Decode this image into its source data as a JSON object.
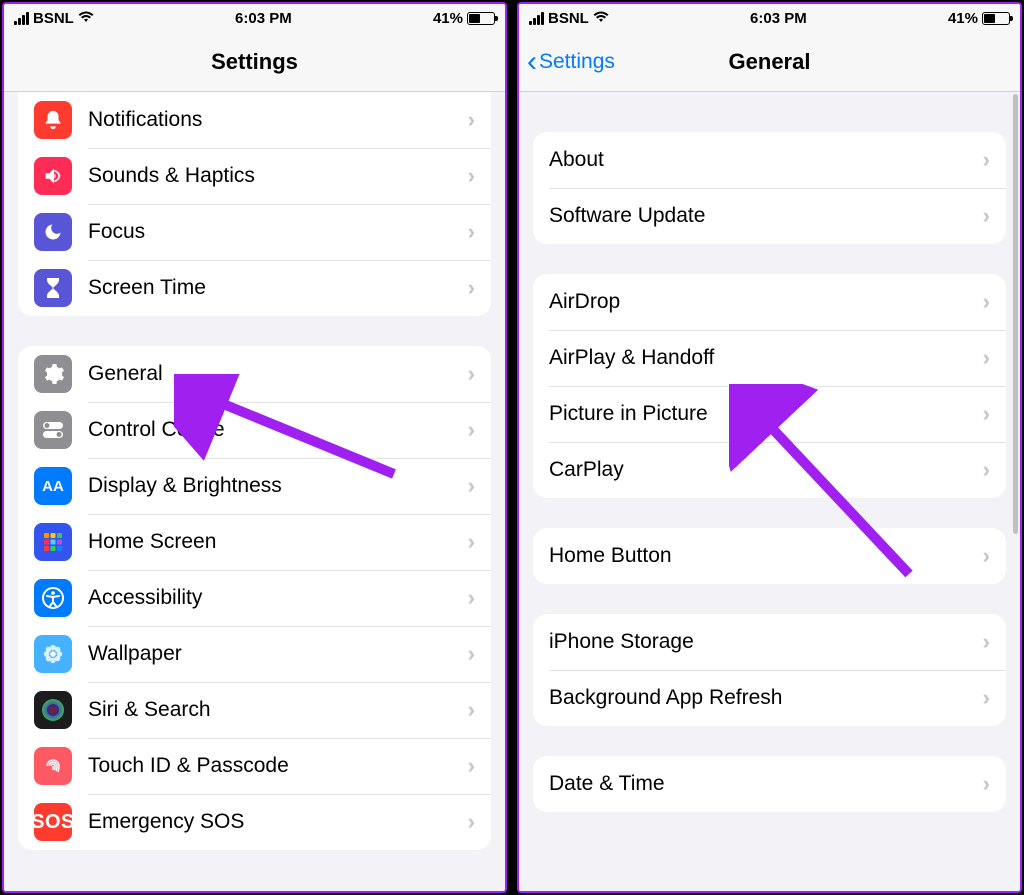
{
  "status": {
    "carrier": "BSNL",
    "time": "6:03 PM",
    "battery_text": "41%"
  },
  "left": {
    "title": "Settings",
    "group1": [
      {
        "label": "Notifications",
        "icon": "bell",
        "icon_bg": "ic-red"
      },
      {
        "label": "Sounds & Haptics",
        "icon": "speaker",
        "icon_bg": "ic-pink"
      },
      {
        "label": "Focus",
        "icon": "moon",
        "icon_bg": "ic-indigo"
      },
      {
        "label": "Screen Time",
        "icon": "hourglass",
        "icon_bg": "ic-indigo"
      }
    ],
    "group2": [
      {
        "label": "General",
        "icon": "gear",
        "icon_bg": "ic-gray"
      },
      {
        "label": "Control Centre",
        "icon": "switches",
        "icon_bg": "ic-gray"
      },
      {
        "label": "Display & Brightness",
        "icon": "AA",
        "icon_bg": "ic-blue"
      },
      {
        "label": "Home Screen",
        "icon": "grid",
        "icon_bg": "ic-grid"
      },
      {
        "label": "Accessibility",
        "icon": "person-circle",
        "icon_bg": "ic-blue"
      },
      {
        "label": "Wallpaper",
        "icon": "flower",
        "icon_bg": "ic-cyan"
      },
      {
        "label": "Siri & Search",
        "icon": "siri",
        "icon_bg": "ic-dark"
      },
      {
        "label": "Touch ID & Passcode",
        "icon": "fingerprint",
        "icon_bg": "ic-touch"
      },
      {
        "label": "Emergency SOS",
        "icon": "SOS",
        "icon_bg": "ic-sos"
      }
    ]
  },
  "right": {
    "back_label": "Settings",
    "title": "General",
    "group1": [
      {
        "label": "About"
      },
      {
        "label": "Software Update"
      }
    ],
    "group2": [
      {
        "label": "AirDrop"
      },
      {
        "label": "AirPlay & Handoff"
      },
      {
        "label": "Picture in Picture"
      },
      {
        "label": "CarPlay"
      }
    ],
    "group3": [
      {
        "label": "Home Button"
      }
    ],
    "group4": [
      {
        "label": "iPhone Storage"
      },
      {
        "label": "Background App Refresh"
      }
    ],
    "group5": [
      {
        "label": "Date & Time"
      }
    ]
  }
}
